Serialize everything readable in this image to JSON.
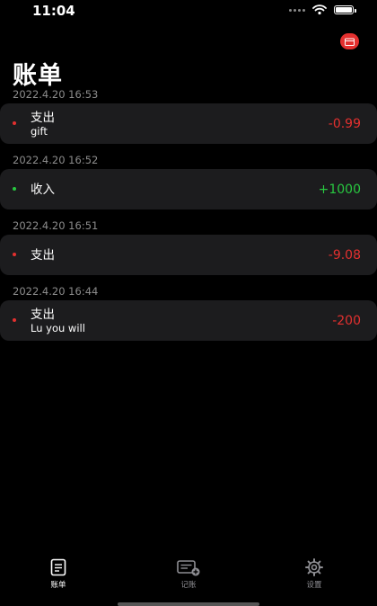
{
  "status_bar": {
    "time": "11:04"
  },
  "page": {
    "title": "账单"
  },
  "bills": [
    {
      "date": "2022.4.20 16:53",
      "type": "支出",
      "note": "gift",
      "amount": "-0.99",
      "color": "#e3302f"
    },
    {
      "date": "2022.4.20 16:52",
      "type": "收入",
      "note": "",
      "amount": "+1000",
      "color": "#28c840"
    },
    {
      "date": "2022.4.20 16:51",
      "type": "支出",
      "note": "",
      "amount": "-9.08",
      "color": "#e3302f"
    },
    {
      "date": "2022.4.20 16:44",
      "type": "支出",
      "note": "Lu you will",
      "amount": "-200",
      "color": "#e3302f"
    }
  ],
  "tabs": [
    {
      "label": "账单",
      "icon": "bill-icon",
      "active": true
    },
    {
      "label": "记账",
      "icon": "add-record-icon",
      "active": false
    },
    {
      "label": "设置",
      "icon": "settings-icon",
      "active": false
    }
  ],
  "colors": {
    "expense": "#e3302f",
    "income": "#28c840",
    "active_tab": "#ffffff",
    "inactive_tab": "#8e8e93"
  }
}
